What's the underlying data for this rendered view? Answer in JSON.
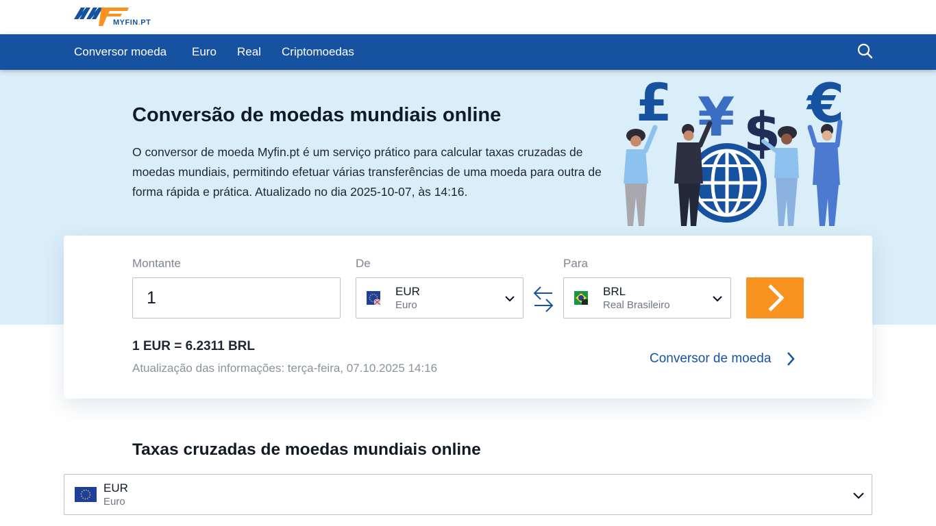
{
  "brand": {
    "name": "MYFIN",
    "tld": "PT",
    "dot": "."
  },
  "nav": {
    "items": [
      "Conversor moeda",
      "Euro",
      "Real",
      "Criptomoedas"
    ],
    "search_icon": "search-icon"
  },
  "hero": {
    "title": "Conversão de moedas mundiais online",
    "description": "O conversor de moeda Myfin.pt é um serviço prático para calcular taxas cruzadas de moedas mundiais, permitindo efetuar várias transferências de uma moeda para outra de forma rápida e prática. Atualizado no dia 2025-10-07, às 14:16."
  },
  "converter": {
    "amount_label": "Montante",
    "amount_value": "1",
    "from_label": "De",
    "from": {
      "code": "EUR",
      "name": "Euro",
      "flag_icon": "eu-flag-icon"
    },
    "to_label": "Para",
    "to": {
      "code": "BRL",
      "name": "Real Brasileiro",
      "flag_icon": "brazil-flag-icon"
    },
    "swap_icon": "swap-arrows-icon",
    "go_icon": "chevron-right-icon",
    "rate_text": "1 EUR = 6.2311 BRL",
    "updated_text": "Atualização das informações: terça-feira, 07.10.2025 14:16",
    "link_text": "Conversor de moeda"
  },
  "cross_rates": {
    "title": "Taxas cruzadas de moedas mundiais online",
    "selected": {
      "code": "EUR",
      "name": "Euro",
      "flag_icon": "eu-flag-icon"
    }
  },
  "colors": {
    "primary": "#1652a0",
    "accent": "#f7931e",
    "hero_bg": "#daeef9"
  }
}
